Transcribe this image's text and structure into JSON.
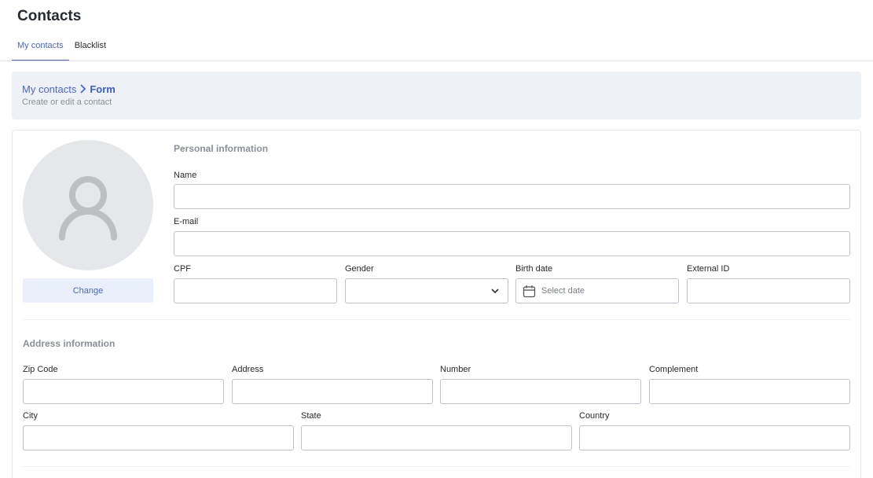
{
  "header": {
    "title": "Contacts"
  },
  "tabs": [
    {
      "label": "My contacts"
    },
    {
      "label": "Blacklist"
    }
  ],
  "breadcrumb": {
    "parent": "My contacts",
    "separator": ">",
    "current": "Form",
    "subtitle": "Create or edit a contact"
  },
  "avatar": {
    "change_label": "Change"
  },
  "personal": {
    "title": "Personal information",
    "name_label": "Name",
    "email_label": "E-mail",
    "cpf_label": "CPF",
    "gender_label": "Gender",
    "birth_label": "Birth date",
    "birth_placeholder": "Select date",
    "external_label": "External ID"
  },
  "address": {
    "title": "Address information",
    "zip_label": "Zip Code",
    "address_label": "Address",
    "number_label": "Number",
    "complement_label": "Complement",
    "city_label": "City",
    "state_label": "State",
    "country_label": "Country"
  },
  "colors": {
    "accent": "#4a66d6",
    "banner_bg": "#eef1f6",
    "avatar_bg": "#e5e7eb",
    "button_bg": "#eaeffc"
  },
  "icons": {
    "avatar": "user-silhouette-icon",
    "breadcrumb_separator": "chevron-right-icon",
    "gender_select": "chevron-down-icon",
    "birth_date": "calendar-icon"
  }
}
